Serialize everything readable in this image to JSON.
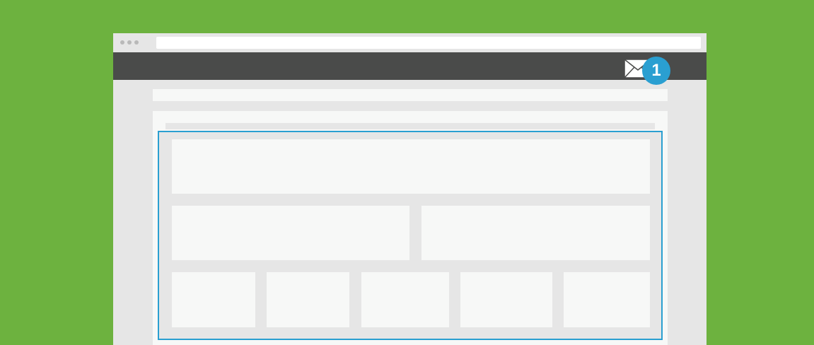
{
  "window": {
    "title_dots": [
      "dot",
      "dot",
      "dot"
    ],
    "address_bar_value": ""
  },
  "navbar": {
    "mail_icon": "envelope-icon",
    "notification_count": "1",
    "badge_color": "#2a9fd1"
  },
  "colors": {
    "background": "#6db23f",
    "navbar": "#4a4b4a",
    "frame": "#e6e6e6",
    "block": "#f7f8f7",
    "selection": "#2a9fd1"
  }
}
